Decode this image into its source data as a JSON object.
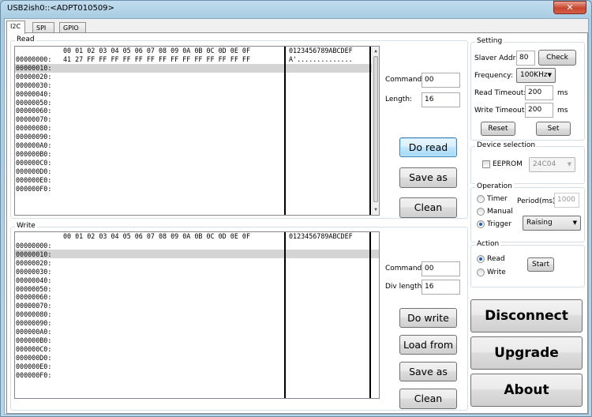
{
  "window": {
    "title": "USB2ish0::<ADPT010509>",
    "close_glyph": "✕"
  },
  "tabs": [
    "I2C",
    "SPI",
    "GPIO"
  ],
  "read": {
    "group_label": "Read",
    "header_hex": "00 01 02 03 04 05 06 07 08 09 0A 0B 0C 0D 0E 0F",
    "header_ascii": "0123456789ABCDEF",
    "addresses": [
      "00000000:",
      "00000010:",
      "00000020:",
      "00000030:",
      "00000040:",
      "00000050:",
      "00000060:",
      "00000070:",
      "00000080:",
      "00000090:",
      "000000A0:",
      "000000B0:",
      "000000C0:",
      "000000D0:",
      "000000E0:",
      "000000F0:"
    ],
    "hex_rows": [
      "41 27 FF FF FF FF FF FF FF FF FF FF FF FF FF FF"
    ],
    "ascii_rows": [
      "A'.............."
    ],
    "command_label": "Command:",
    "command_value": "00",
    "length_label": "Length:",
    "length_value": "16",
    "do_read": "Do read",
    "save_as": "Save as",
    "clean": "Clean"
  },
  "write": {
    "group_label": "Write",
    "header_hex": "00 01 02 03 04 05 06 07 08 09 0A 0B 0C 0D 0E 0F",
    "header_ascii": "0123456789ABCDEF",
    "addresses": [
      "00000000:",
      "00000010:",
      "00000020:",
      "00000030:",
      "00000040:",
      "00000050:",
      "00000060:",
      "00000070:",
      "00000080:",
      "00000090:",
      "000000A0:",
      "000000B0:",
      "000000C0:",
      "000000D0:",
      "000000E0:",
      "000000F0:"
    ],
    "command_label": "Command:",
    "command_value": "00",
    "div_length_label": "Div length:",
    "div_length_value": "16",
    "do_write": "Do write",
    "load_from": "Load from",
    "save_as": "Save as",
    "clean": "Clean"
  },
  "setting": {
    "group_label": "Setting",
    "slaver_addr_label": "Slaver Addr:",
    "slaver_addr_value": "80",
    "check": "Check",
    "frequency_label": "Frequency:",
    "frequency_value": "100KHz",
    "read_timeout_label": "Read Timeout:",
    "read_timeout_value": "200",
    "write_timeout_label": "Write Timeout:",
    "write_timeout_value": "200",
    "ms": "ms",
    "reset": "Reset",
    "set": "Set"
  },
  "device_selection": {
    "group_label": "Device selection",
    "eeprom_label": "EEPROM",
    "eeprom_checked": false,
    "device_value": "24C04"
  },
  "operation": {
    "group_label": "Operation",
    "timer": "Timer",
    "manual": "Manual",
    "trigger": "Trigger",
    "selected": "Trigger",
    "period_label": "Period(ms)",
    "period_value": "1000",
    "trigger_edge": "Raising"
  },
  "action": {
    "group_label": "Action",
    "read": "Read",
    "write": "Write",
    "selected": "Read",
    "start": "Start"
  },
  "buttons": {
    "disconnect": "Disconnect",
    "upgrade": "Upgrade",
    "about": "About"
  }
}
